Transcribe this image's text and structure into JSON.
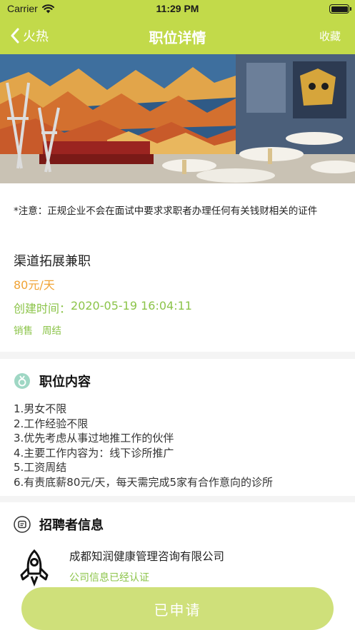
{
  "status_bar": {
    "carrier": "Carrier",
    "time": "11:29 PM"
  },
  "nav": {
    "back_label": "火热",
    "title": "职位详情",
    "favorite_label": "收藏"
  },
  "job": {
    "notice": "*注意：正规企业不会在面试中要求求职者办理任何有关钱财相关的证件",
    "title": "渠道拓展兼职",
    "salary": "80元/天",
    "created_label": "创建时间：",
    "created_value": "2020-05-19 16:04:11",
    "tags": [
      "销售",
      "周结"
    ]
  },
  "content_section": {
    "heading": "职位内容",
    "lines": [
      "1.男女不限",
      "2.工作经验不限",
      "3.优先考虑从事过地推工作的伙伴",
      "4.主要工作内容为：线下诊所推广",
      "5.工资周结",
      "6.有责底薪80元/天，每天需完成5家有合作意向的诊所"
    ]
  },
  "recruiter_section": {
    "heading": "招聘者信息",
    "company_name": "成都知润健康管理咨询有限公司",
    "verified_text": "公司信息已经认证"
  },
  "apply_button": {
    "label": "已申请"
  },
  "colors": {
    "brand": "#c2da4a",
    "accent_green": "#8cc44a",
    "salary_orange": "#f0a335",
    "button_bg": "#cfe07a"
  },
  "icons": {
    "back": "chevron-left-icon",
    "content": "medal-icon",
    "recruiter": "chat-card-icon",
    "company_logo": "rocket-icon",
    "wifi": "wifi-icon",
    "battery": "battery-icon"
  }
}
